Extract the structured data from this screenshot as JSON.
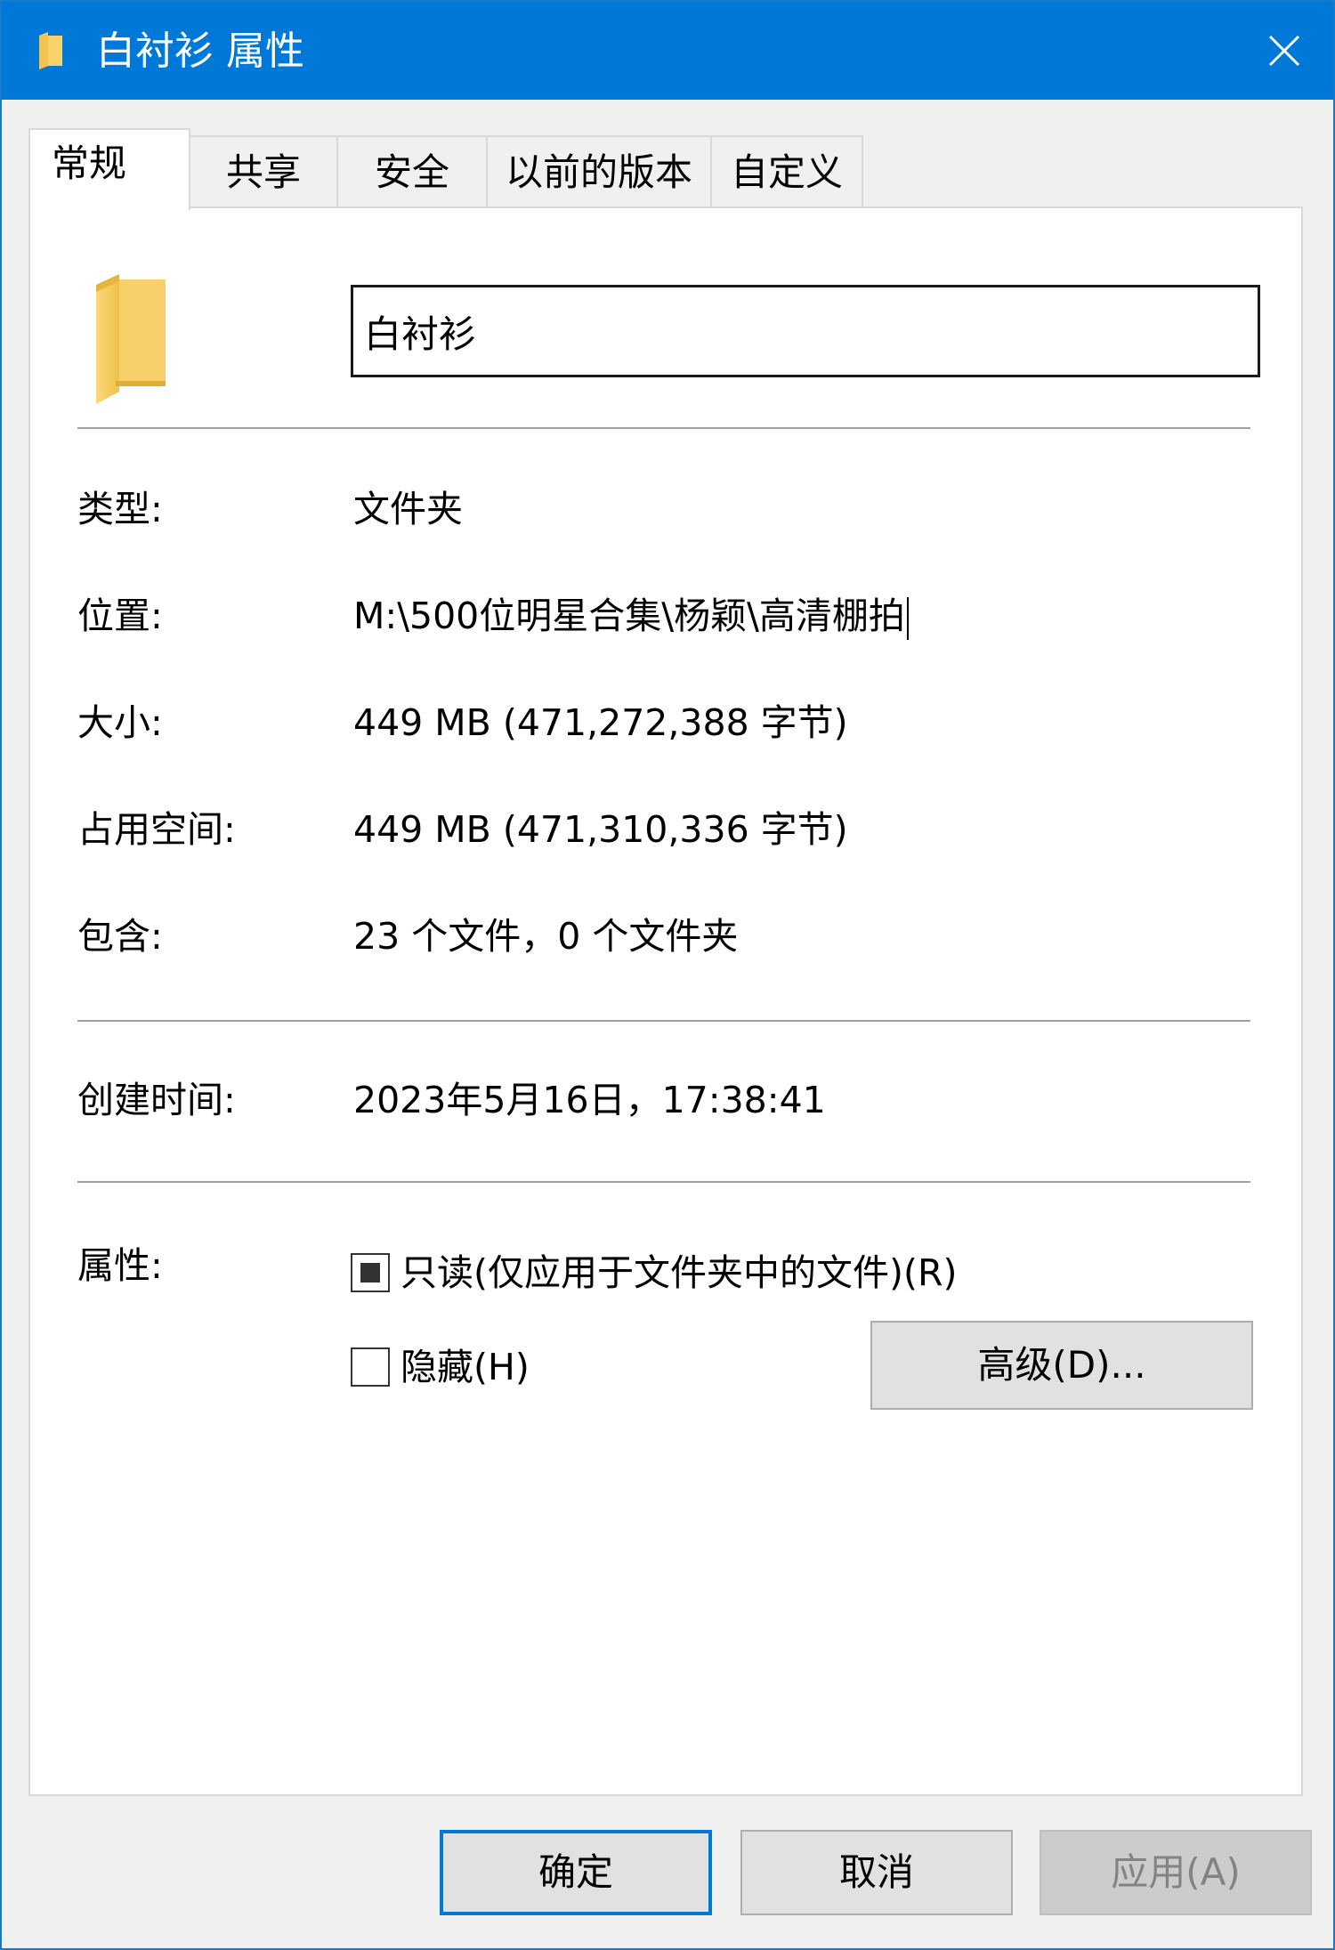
{
  "window": {
    "title": "白衬衫 属性"
  },
  "tabs": [
    {
      "label": "常规",
      "active": true
    },
    {
      "label": "共享",
      "active": false
    },
    {
      "label": "安全",
      "active": false
    },
    {
      "label": "以前的版本",
      "active": false
    },
    {
      "label": "自定义",
      "active": false
    }
  ],
  "general": {
    "folder_name": "白衬衫",
    "rows": [
      {
        "label": "类型:",
        "value": "文件夹"
      },
      {
        "label": "位置:",
        "value": "M:\\500位明星合集\\杨颖\\高清棚拍"
      },
      {
        "label": "大小:",
        "value": "449 MB (471,272,388 字节)"
      },
      {
        "label": "占用空间:",
        "value": "449 MB (471,310,336 字节)"
      },
      {
        "label": "包含:",
        "value": "23 个文件，0 个文件夹"
      }
    ],
    "created": {
      "label": "创建时间:",
      "value": "2023年5月16日，17:38:41"
    },
    "attributes": {
      "label": "属性:",
      "readonly": {
        "label": "只读(仅应用于文件夹中的文件)(R)",
        "state": "indeterminate"
      },
      "hidden": {
        "label": "隐藏(H)",
        "state": "unchecked"
      },
      "advanced_label": "高级(D)..."
    }
  },
  "footer": {
    "ok_label": "确定",
    "cancel_label": "取消",
    "apply_label": "应用(A)"
  },
  "colors": {
    "titlebar": "#0078d7",
    "folder": "#f4c453",
    "button_face": "#e1e1e1",
    "focus_border": "#0078d7"
  },
  "icons": {
    "title": "folder-icon",
    "close": "close-icon",
    "properties": "folder-large-icon"
  }
}
